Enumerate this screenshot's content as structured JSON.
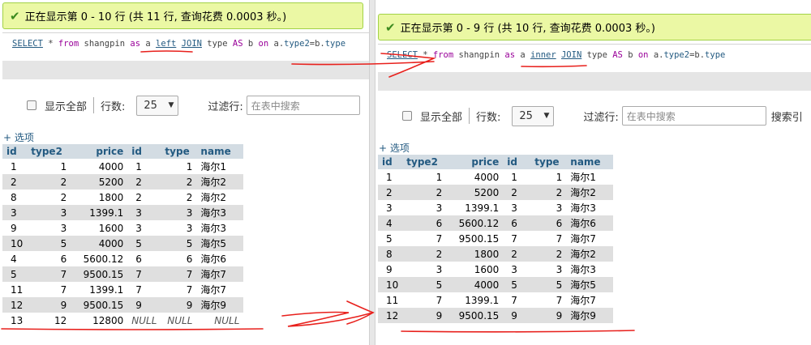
{
  "left": {
    "success_message": "正在显示第 0 - 10 行 (共 11 行, 查询花费 0.0003 秒。)",
    "sql": [
      "SELECT",
      " * ",
      "from",
      " shangpin ",
      "as",
      " a ",
      "left",
      " ",
      "JOIN",
      " type ",
      "AS",
      " b ",
      "on",
      " a.",
      "type2",
      "=b.",
      "type"
    ],
    "controls": {
      "show_all": "显示全部",
      "rows_label": "行数:",
      "rows_value": "25",
      "filter_label": "过滤行:",
      "filter_placeholder": "在表中搜索"
    },
    "options_link": "+ 选项",
    "columns": [
      "id",
      "type2",
      "price",
      "id",
      "type",
      "name"
    ],
    "rows": [
      [
        "1",
        "1",
        "4000",
        "1",
        "1",
        "海尔1"
      ],
      [
        "2",
        "2",
        "5200",
        "2",
        "2",
        "海尔2"
      ],
      [
        "8",
        "2",
        "1800",
        "2",
        "2",
        "海尔2"
      ],
      [
        "3",
        "3",
        "1399.1",
        "3",
        "3",
        "海尔3"
      ],
      [
        "9",
        "3",
        "1600",
        "3",
        "3",
        "海尔3"
      ],
      [
        "10",
        "5",
        "4000",
        "5",
        "5",
        "海尔5"
      ],
      [
        "4",
        "6",
        "5600.12",
        "6",
        "6",
        "海尔6"
      ],
      [
        "5",
        "7",
        "9500.15",
        "7",
        "7",
        "海尔7"
      ],
      [
        "11",
        "7",
        "1399.1",
        "7",
        "7",
        "海尔7"
      ],
      [
        "12",
        "9",
        "9500.15",
        "9",
        "9",
        "海尔9"
      ],
      [
        "13",
        "12",
        "12800",
        "NULL",
        "NULL",
        "NULL"
      ]
    ]
  },
  "right": {
    "success_message": "正在显示第 0 - 9 行 (共 10 行, 查询花费 0.0003 秒。)",
    "sql": [
      "SELECT",
      " * ",
      "from",
      " shangpin ",
      "as",
      " a ",
      "inner",
      " ",
      "JOIN",
      " type ",
      "AS",
      " b ",
      "on",
      " a.",
      "type2",
      "=b.",
      "type"
    ],
    "controls": {
      "show_all": "显示全部",
      "rows_label": "行数:",
      "rows_value": "25",
      "filter_label": "过滤行:",
      "filter_placeholder": "在表中搜索",
      "search_cut": "搜索引"
    },
    "options_link": "+ 选项",
    "columns": [
      "id",
      "type2",
      "price",
      "id",
      "type",
      "name"
    ],
    "rows": [
      [
        "1",
        "1",
        "4000",
        "1",
        "1",
        "海尔1"
      ],
      [
        "2",
        "2",
        "5200",
        "2",
        "2",
        "海尔2"
      ],
      [
        "3",
        "3",
        "1399.1",
        "3",
        "3",
        "海尔3"
      ],
      [
        "4",
        "6",
        "5600.12",
        "6",
        "6",
        "海尔6"
      ],
      [
        "5",
        "7",
        "9500.15",
        "7",
        "7",
        "海尔7"
      ],
      [
        "8",
        "2",
        "1800",
        "2",
        "2",
        "海尔2"
      ],
      [
        "9",
        "3",
        "1600",
        "3",
        "3",
        "海尔3"
      ],
      [
        "10",
        "5",
        "4000",
        "5",
        "5",
        "海尔5"
      ],
      [
        "11",
        "7",
        "1399.1",
        "7",
        "7",
        "海尔7"
      ],
      [
        "12",
        "9",
        "9500.15",
        "9",
        "9",
        "海尔9"
      ]
    ]
  },
  "colors": {
    "annotation": "#e8201c",
    "success_bg": "#ebf8a4",
    "header_bg": "#d3dce3",
    "link": "#235a81",
    "keyword": "#990099"
  }
}
